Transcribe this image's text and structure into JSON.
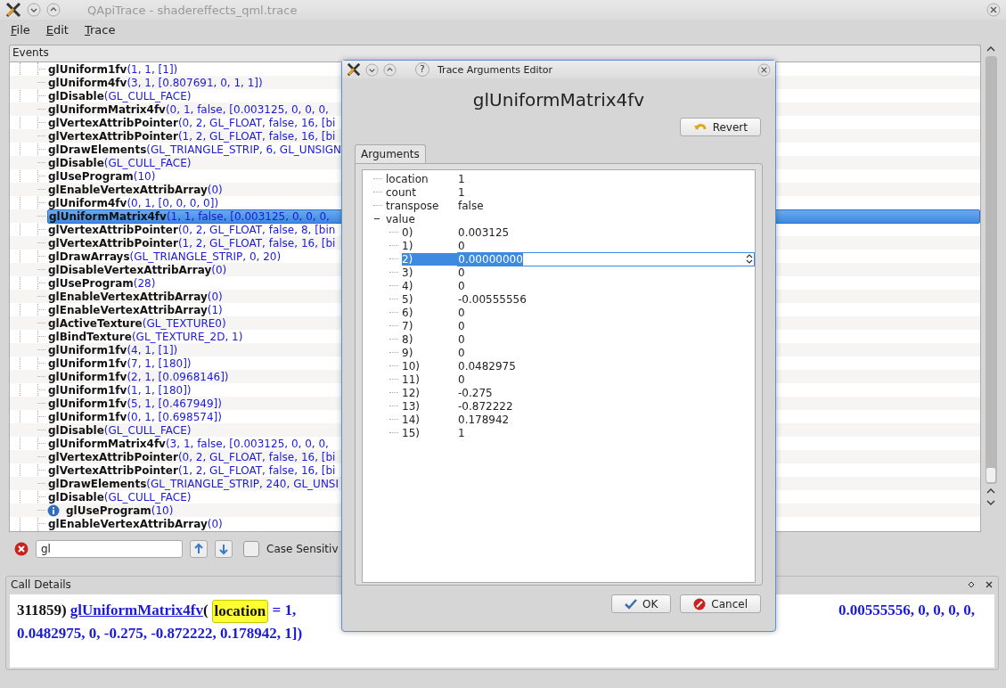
{
  "window": {
    "title": "QApiTrace - shadereffects_qml.trace"
  },
  "menu": [
    "File",
    "Edit",
    "Trace"
  ],
  "events": {
    "title": "Events",
    "rows": [
      {
        "name": "glUniform1fv",
        "args": "(1, 1, [1])",
        "selected": false,
        "kind": "call"
      },
      {
        "name": "glUniform4fv",
        "args": "(3, 1, [0.807691, 0, 1, 1])",
        "selected": false,
        "kind": "call"
      },
      {
        "name": "glDisable",
        "args": "(GL_CULL_FACE)",
        "selected": false,
        "kind": "call"
      },
      {
        "name": "glUniformMatrix4fv",
        "args": "(0, 1, false, [0.003125, 0, 0, 0,",
        "selected": false,
        "kind": "call"
      },
      {
        "name": "glVertexAttribPointer",
        "args": "(0, 2, GL_FLOAT, false, 16, [bi",
        "selected": false,
        "kind": "call"
      },
      {
        "name": "glVertexAttribPointer",
        "args": "(1, 2, GL_FLOAT, false, 16, [bi",
        "selected": false,
        "kind": "call"
      },
      {
        "name": "glDrawElements",
        "args": "(GL_TRIANGLE_STRIP, 6, GL_UNSIGN",
        "selected": false,
        "kind": "call"
      },
      {
        "name": "glDisable",
        "args": "(GL_CULL_FACE)",
        "selected": false,
        "kind": "call"
      },
      {
        "name": "glUseProgram",
        "args": "(10)",
        "selected": false,
        "kind": "call"
      },
      {
        "name": "glEnableVertexAttribArray",
        "args": "(0)",
        "selected": false,
        "kind": "call"
      },
      {
        "name": "glUniform4fv",
        "args": "(0, 1, [0, 0, 0, 0])",
        "selected": false,
        "kind": "call"
      },
      {
        "name": "glUniformMatrix4fv",
        "args": "(1, 1, false, [0.003125, 0, 0, 0,",
        "selected": true,
        "kind": "call"
      },
      {
        "name": "glVertexAttribPointer",
        "args": "(0, 2, GL_FLOAT, false, 8, [bin",
        "selected": false,
        "kind": "call"
      },
      {
        "name": "glVertexAttribPointer",
        "args": "(1, 2, GL_FLOAT, false, 16, [bi",
        "selected": false,
        "kind": "call"
      },
      {
        "name": "glDrawArrays",
        "args": "(GL_TRIANGLE_STRIP, 0, 20)",
        "selected": false,
        "kind": "call"
      },
      {
        "name": "glDisableVertexAttribArray",
        "args": "(0)",
        "selected": false,
        "kind": "call"
      },
      {
        "name": "glUseProgram",
        "args": "(28)",
        "selected": false,
        "kind": "call"
      },
      {
        "name": "glEnableVertexAttribArray",
        "args": "(0)",
        "selected": false,
        "kind": "call"
      },
      {
        "name": "glEnableVertexAttribArray",
        "args": "(1)",
        "selected": false,
        "kind": "call"
      },
      {
        "name": "glActiveTexture",
        "args": "(GL_TEXTURE0)",
        "selected": false,
        "kind": "call"
      },
      {
        "name": "glBindTexture",
        "args": "(GL_TEXTURE_2D, 1)",
        "selected": false,
        "kind": "call"
      },
      {
        "name": "glUniform1fv",
        "args": "(4, 1, [1])",
        "selected": false,
        "kind": "call"
      },
      {
        "name": "glUniform1fv",
        "args": "(7, 1, [180])",
        "selected": false,
        "kind": "call"
      },
      {
        "name": "glUniform1fv",
        "args": "(2, 1, [0.0968146])",
        "selected": false,
        "kind": "call"
      },
      {
        "name": "glUniform1fv",
        "args": "(1, 1, [180])",
        "selected": false,
        "kind": "call"
      },
      {
        "name": "glUniform1fv",
        "args": "(5, 1, [0.467949])",
        "selected": false,
        "kind": "call"
      },
      {
        "name": "glUniform1fv",
        "args": "(0, 1, [0.698574])",
        "selected": false,
        "kind": "call"
      },
      {
        "name": "glDisable",
        "args": "(GL_CULL_FACE)",
        "selected": false,
        "kind": "call"
      },
      {
        "name": "glUniformMatrix4fv",
        "args": "(3, 1, false, [0.003125, 0, 0, 0,",
        "selected": false,
        "kind": "call"
      },
      {
        "name": "glVertexAttribPointer",
        "args": "(0, 2, GL_FLOAT, false, 16, [bi",
        "selected": false,
        "kind": "call"
      },
      {
        "name": "glVertexAttribPointer",
        "args": "(1, 2, GL_FLOAT, false, 16, [bi",
        "selected": false,
        "kind": "call"
      },
      {
        "name": "glDrawElements",
        "args": "(GL_TRIANGLE_STRIP, 240, GL_UNSI",
        "selected": false,
        "kind": "call"
      },
      {
        "name": "glDisable",
        "args": "(GL_CULL_FACE)",
        "selected": false,
        "kind": "call"
      },
      {
        "name": "glUseProgram",
        "args": "(10)",
        "selected": false,
        "kind": "info"
      },
      {
        "name": "glEnableVertexAttribArray",
        "args": "(0)",
        "selected": false,
        "kind": "call"
      }
    ]
  },
  "search": {
    "value": "gl",
    "case_sensitive": {
      "label": "Case Sensitiv",
      "checked": false
    }
  },
  "call_details": {
    "title": "Call Details",
    "number": "311859)",
    "function": "glUniformMatrix4fv",
    "open_paren": "(",
    "param": "location",
    "assign": " = 1, ",
    "line1_tail": "0.00555556, 0, 0, 0, 0,",
    "line2": "0.0482975, 0, -0.275, -0.872222, 0.178942, 1])"
  },
  "dialog": {
    "title": "Trace Arguments Editor",
    "help": "?",
    "heading": "glUniformMatrix4fv",
    "revert": "Revert",
    "tab": "Arguments",
    "ok": "OK",
    "cancel": "Cancel",
    "arguments": [
      {
        "name": "location",
        "value": "1",
        "selected": false
      },
      {
        "name": "count",
        "value": "1",
        "selected": false
      },
      {
        "name": "transpose",
        "value": "false",
        "selected": false
      },
      {
        "name": "value",
        "expanded": true,
        "selected": false,
        "children": [
          {
            "name": "0)",
            "value": "0.003125",
            "selected": false
          },
          {
            "name": "1)",
            "value": "0",
            "selected": false
          },
          {
            "name": "2)",
            "value": "0.00000000",
            "selected": true
          },
          {
            "name": "3)",
            "value": "0",
            "selected": false
          },
          {
            "name": "4)",
            "value": "0",
            "selected": false
          },
          {
            "name": "5)",
            "value": "-0.00555556",
            "selected": false
          },
          {
            "name": "6)",
            "value": "0",
            "selected": false
          },
          {
            "name": "7)",
            "value": "0",
            "selected": false
          },
          {
            "name": "8)",
            "value": "0",
            "selected": false
          },
          {
            "name": "9)",
            "value": "0",
            "selected": false
          },
          {
            "name": "10)",
            "value": "0.0482975",
            "selected": false
          },
          {
            "name": "11)",
            "value": "0",
            "selected": false
          },
          {
            "name": "12)",
            "value": "-0.275",
            "selected": false
          },
          {
            "name": "13)",
            "value": "-0.872222",
            "selected": false
          },
          {
            "name": "14)",
            "value": "0.178942",
            "selected": false
          },
          {
            "name": "15)",
            "value": "1",
            "selected": false
          }
        ]
      }
    ]
  }
}
